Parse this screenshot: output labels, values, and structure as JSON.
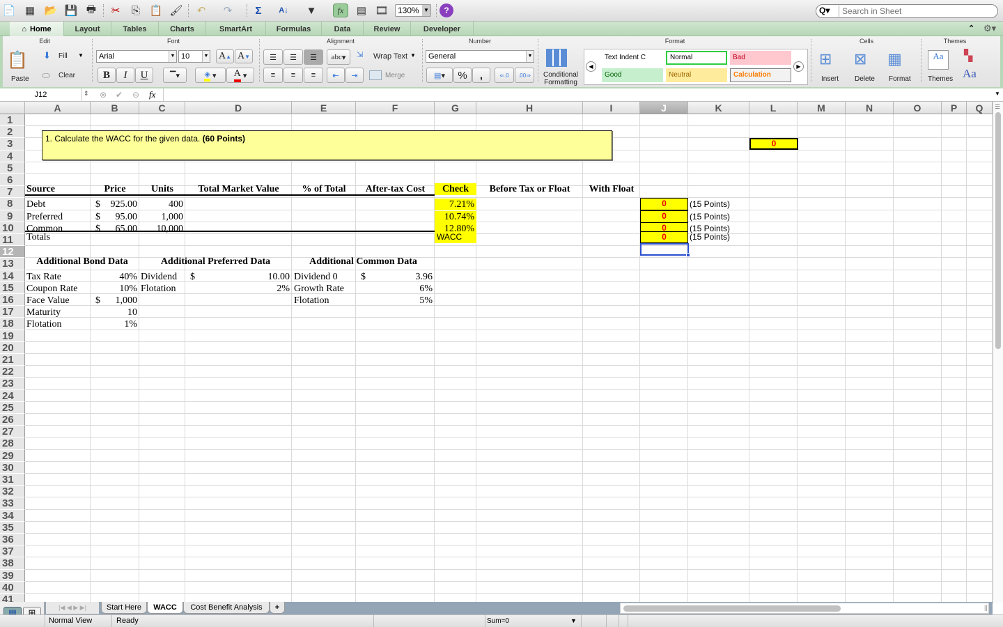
{
  "toolbar": {
    "zoom_level": "130%",
    "search_placeholder": "Search in Sheet",
    "icons": [
      "new-icon",
      "templates-icon",
      "open-icon",
      "save-icon",
      "print-icon",
      "cut-icon",
      "copy-icon",
      "paste-icon",
      "format-painter-icon",
      "undo-icon",
      "redo-icon",
      "autosum-icon",
      "sort-icon",
      "filter-icon",
      "function-icon",
      "formula-builder-icon",
      "media-browser-icon",
      "help-icon"
    ]
  },
  "ribbon_tabs": [
    "Home",
    "Layout",
    "Tables",
    "Charts",
    "SmartArt",
    "Formulas",
    "Data",
    "Review",
    "Developer"
  ],
  "active_tab": "Home",
  "ribbon": {
    "groups": {
      "edit": "Edit",
      "font": "Font",
      "alignment": "Alignment",
      "number": "Number",
      "format": "Format",
      "cells": "Cells",
      "themes": "Themes"
    },
    "paste": "Paste",
    "fill": "Fill",
    "clear": "Clear",
    "font_name": "Arial",
    "font_size": "10",
    "bold": "B",
    "italic": "I",
    "underline": "U",
    "wrap_text": "Wrap Text",
    "merge": "Merge",
    "abc": "abc",
    "number_format": "General",
    "percent": "%",
    "comma": ",",
    "increase_decimal": "←.0 .00",
    "decrease_decimal": ".00 →.0",
    "conditional_formatting": [
      "Conditional",
      "Formatting"
    ],
    "styles": [
      {
        "label": "Text Indent C",
        "bg": "#ffffff",
        "fg": "#000000",
        "border": "#ffffff"
      },
      {
        "label": "Normal",
        "bg": "#ffffff",
        "fg": "#000000",
        "border": "#2ecc40"
      },
      {
        "label": "Bad",
        "bg": "#ffc7ce",
        "fg": "#9c0006",
        "border": "#ffc7ce"
      },
      {
        "label": "Good",
        "bg": "#c6efce",
        "fg": "#006100",
        "border": "#c6efce"
      },
      {
        "label": "Neutral",
        "bg": "#ffeb9c",
        "fg": "#9c6500",
        "border": "#ffeb9c"
      },
      {
        "label": "Calculation",
        "bg": "#f2f2f2",
        "fg": "#fa7d00",
        "border": "#7f7f7f"
      }
    ],
    "insert": "Insert",
    "delete": "Delete",
    "format": "Format",
    "themes": "Themes",
    "aa": "Aa"
  },
  "formula_bar": {
    "name_box": "J12",
    "fx": "fx",
    "content": ""
  },
  "columns": [
    "A",
    "B",
    "C",
    "D",
    "E",
    "F",
    "G",
    "H",
    "I",
    "J",
    "K",
    "L",
    "M",
    "N",
    "O",
    "P",
    "Q"
  ],
  "selected_cell": "J12",
  "rows": 43,
  "sheet": {
    "question": {
      "text": "1.  Calculate the WACC for the given data. ",
      "bold": "(60 Points)"
    },
    "l3_value": "0",
    "headers": {
      "source": "Source",
      "price": "Price",
      "units": "Units",
      "tmv": "Total Market Value",
      "pct": "% of Total",
      "atc": "After-tax Cost",
      "check": "Check",
      "btf": "Before Tax or Float",
      "wf": "With Float"
    },
    "capital": [
      {
        "source": "Debt",
        "price_sym": "$",
        "price": "925.00",
        "units": "400",
        "check": "7.21%",
        "score": "0",
        "points": "(15 Points)"
      },
      {
        "source": "Preferred",
        "price_sym": "$",
        "price": "95.00",
        "units": "1,000",
        "check": "10.74%",
        "score": "0",
        "points": "(15 Points)"
      },
      {
        "source": "Common",
        "price_sym": "$",
        "price": "65.00",
        "units": "10,000",
        "check": "12.80%",
        "score": "0",
        "points": "(15 Points)"
      }
    ],
    "totals": {
      "label": "Totals",
      "check": "WACC",
      "score": "0",
      "points": "(15 Points)"
    },
    "bond": {
      "title": "Additional Bond Data",
      "rows": [
        {
          "label": "Tax Rate",
          "sym": "",
          "value": "40%"
        },
        {
          "label": "Coupon Rate",
          "sym": "",
          "value": "10%"
        },
        {
          "label": "Face Value",
          "sym": "$",
          "value": "1,000"
        },
        {
          "label": "Maturity",
          "sym": "",
          "value": "10"
        },
        {
          "label": "Flotation",
          "sym": "",
          "value": "1%"
        }
      ]
    },
    "preferred": {
      "title": "Additional Preferred Data",
      "rows": [
        {
          "label": "Dividend",
          "sym": "$",
          "value": "10.00"
        },
        {
          "label": "Flotation",
          "sym": "",
          "value": "2%"
        }
      ]
    },
    "common": {
      "title": "Additional Common Data",
      "rows": [
        {
          "label": "Dividend 0",
          "sym": "$",
          "value": "3.96"
        },
        {
          "label": "Growth Rate",
          "sym": "",
          "value": "6%"
        },
        {
          "label": "Flotation",
          "sym": "",
          "value": "5%"
        }
      ]
    }
  },
  "sheet_tabs": [
    "Start Here",
    "WACC",
    "Cost Benefit Analysis"
  ],
  "active_sheet": "WACC",
  "add_sheet": "+",
  "status": {
    "view": "Normal View",
    "ready": "Ready",
    "sum": "Sum=0"
  }
}
